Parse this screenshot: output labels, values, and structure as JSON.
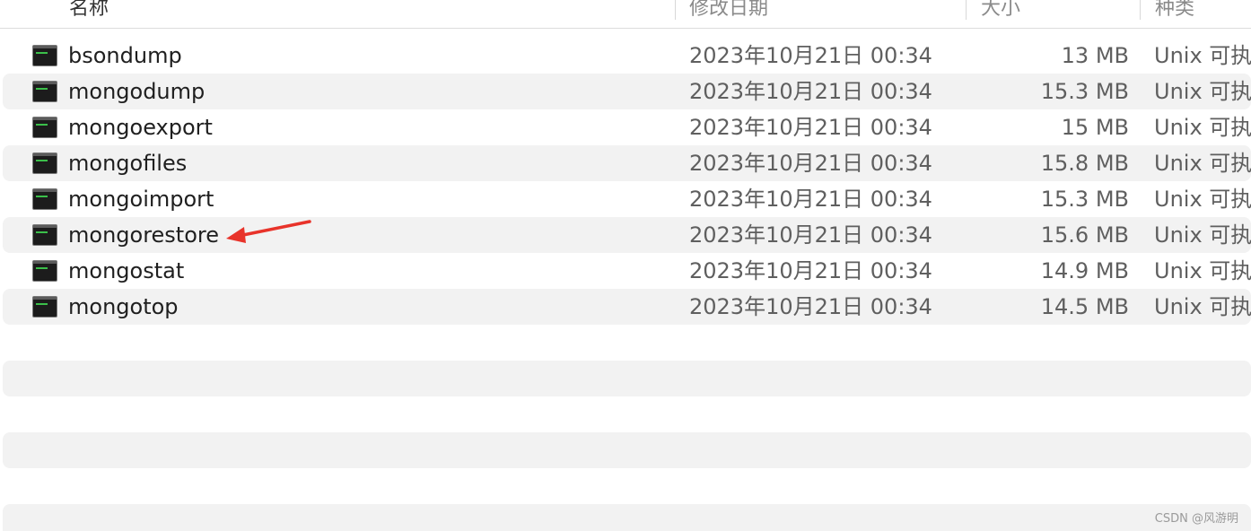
{
  "header": {
    "name_label": "名称",
    "date_label": "修改日期",
    "size_label": "大小",
    "kind_label": "种类",
    "sort_indicator": "chevron-up-icon"
  },
  "files": [
    {
      "name": "bsondump",
      "date": "2023年10月21日 00:34",
      "size": "13 MB",
      "kind": "Unix 可执"
    },
    {
      "name": "mongodump",
      "date": "2023年10月21日 00:34",
      "size": "15.3 MB",
      "kind": "Unix 可执"
    },
    {
      "name": "mongoexport",
      "date": "2023年10月21日 00:34",
      "size": "15 MB",
      "kind": "Unix 可执"
    },
    {
      "name": "mongofiles",
      "date": "2023年10月21日 00:34",
      "size": "15.8 MB",
      "kind": "Unix 可执"
    },
    {
      "name": "mongoimport",
      "date": "2023年10月21日 00:34",
      "size": "15.3 MB",
      "kind": "Unix 可执"
    },
    {
      "name": "mongorestore",
      "date": "2023年10月21日 00:34",
      "size": "15.6 MB",
      "kind": "Unix 可执"
    },
    {
      "name": "mongostat",
      "date": "2023年10月21日 00:34",
      "size": "14.9 MB",
      "kind": "Unix 可执"
    },
    {
      "name": "mongotop",
      "date": "2023年10月21日 00:34",
      "size": "14.5 MB",
      "kind": "Unix 可执"
    }
  ],
  "file_icon": "terminal-executable-icon",
  "annotation": {
    "icon": "red-arrow-icon",
    "color": "#e8332a"
  },
  "colors": {
    "row_alt": "#f2f2f2",
    "header_border": "#dcdcdc"
  },
  "watermark": "CSDN @风游明"
}
